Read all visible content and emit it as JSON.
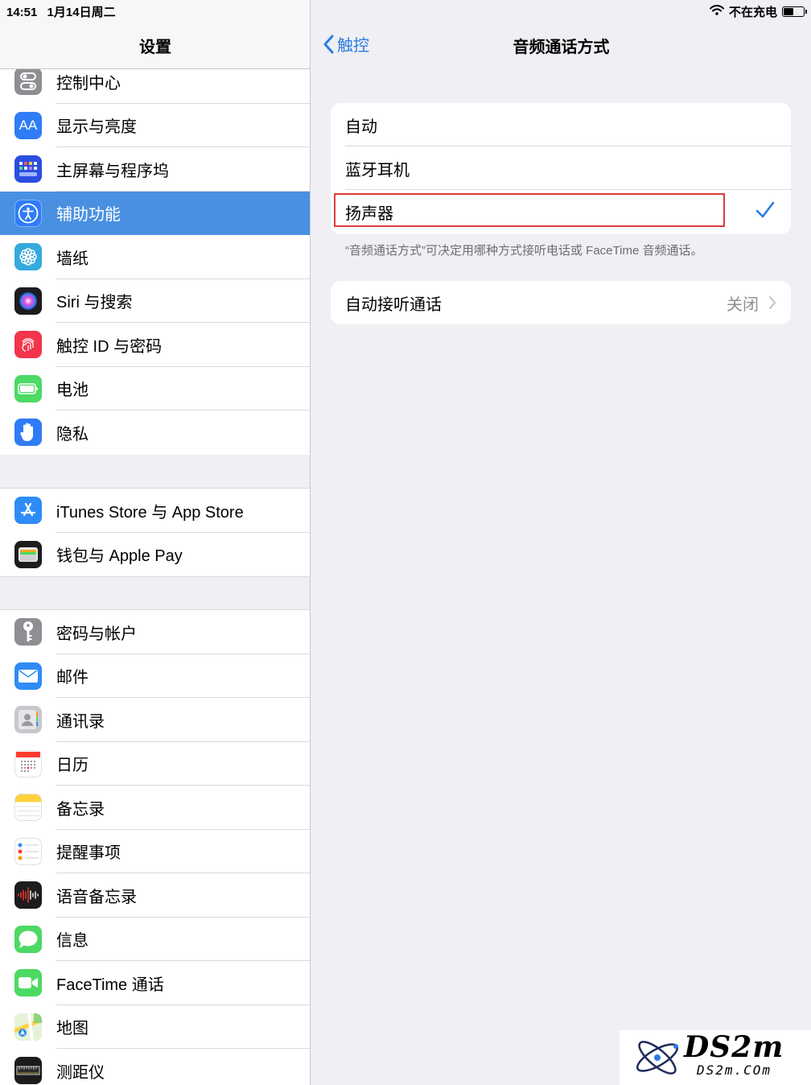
{
  "status_bar": {
    "time": "14:51",
    "date": "1月14日周二",
    "charging": "不在充电"
  },
  "sidebar": {
    "title": "设置",
    "groups": [
      {
        "items": [
          {
            "label": "控制中心",
            "icon": "control-center-icon",
            "color": "#8e8e93"
          },
          {
            "label": "显示与亮度",
            "icon": "display-icon",
            "color": "#2f7cf6"
          },
          {
            "label": "主屏幕与程序坞",
            "icon": "home-screen-icon",
            "color": "#2b4ee0"
          },
          {
            "label": "辅助功能",
            "icon": "accessibility-icon",
            "color": "#2f7cf6",
            "selected": true
          },
          {
            "label": "墙纸",
            "icon": "wallpaper-icon",
            "color": "#35aadc"
          },
          {
            "label": "Siri 与搜索",
            "icon": "siri-icon",
            "color": "#222222"
          },
          {
            "label": "触控 ID 与密码",
            "icon": "touch-id-icon",
            "color": "#f2354a"
          },
          {
            "label": "电池",
            "icon": "battery-icon",
            "color": "#4cd964"
          },
          {
            "label": "隐私",
            "icon": "privacy-hand-icon",
            "color": "#2f7cf6"
          }
        ]
      },
      {
        "items": [
          {
            "label": "iTunes Store 与 App Store",
            "icon": "app-store-icon",
            "color": "#2f8cf6"
          },
          {
            "label": "钱包与 Apple Pay",
            "icon": "wallet-icon",
            "color": "#1c1c1e"
          }
        ]
      },
      {
        "items": [
          {
            "label": "密码与帐户",
            "icon": "key-icon",
            "color": "#8e8e93"
          },
          {
            "label": "邮件",
            "icon": "mail-icon",
            "color": "#2f8cf6"
          },
          {
            "label": "通讯录",
            "icon": "contacts-icon",
            "color": "#c7c7cc"
          },
          {
            "label": "日历",
            "icon": "calendar-icon",
            "color": "#ffffff"
          },
          {
            "label": "备忘录",
            "icon": "notes-icon",
            "color": "#ffffff"
          },
          {
            "label": "提醒事项",
            "icon": "reminders-icon",
            "color": "#ffffff"
          },
          {
            "label": "语音备忘录",
            "icon": "voice-memos-icon",
            "color": "#1c1c1e"
          },
          {
            "label": "信息",
            "icon": "messages-icon",
            "color": "#4cd964"
          },
          {
            "label": "FaceTime 通话",
            "icon": "facetime-icon",
            "color": "#4cd964"
          },
          {
            "label": "地图",
            "icon": "maps-icon",
            "color": "#8fd27c"
          },
          {
            "label": "测距仪",
            "icon": "measure-icon",
            "color": "#1c1c1e"
          }
        ]
      }
    ]
  },
  "main": {
    "back_label": "触控",
    "title": "音频通话方式",
    "options": [
      "自动",
      "蓝牙耳机",
      "扬声器"
    ],
    "selected_option": "扬声器",
    "footnote": "“音频通话方式”可决定用哪种方式接听电话或 FaceTime 音频通话。",
    "auto_answer": {
      "label": "自动接听通话",
      "value": "关闭"
    }
  },
  "watermark": {
    "title": "DS2m",
    "subtitle": "DS2m.COm"
  },
  "colors": {
    "accent": "#2c7be5",
    "selected_row": "#4a90e2",
    "highlight_border": "#e03a3a"
  }
}
